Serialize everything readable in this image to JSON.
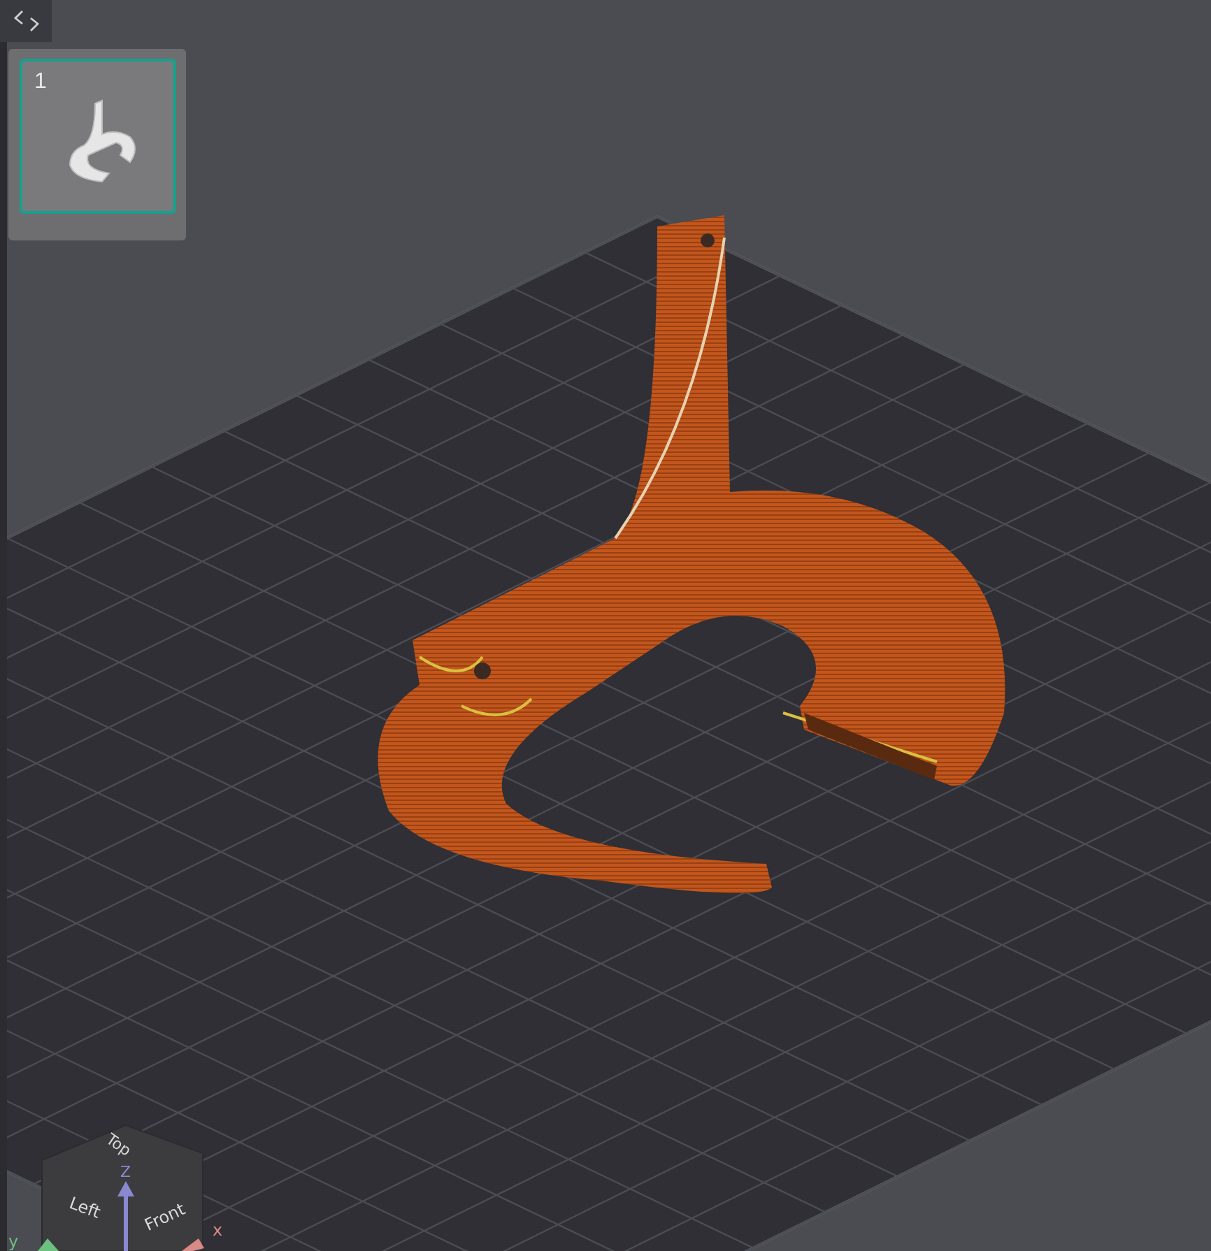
{
  "plate_list": {
    "plates": [
      {
        "number": "1",
        "selected": true
      }
    ]
  },
  "view_cube": {
    "top": "Top",
    "left": "Left",
    "front": "Front"
  },
  "axes": {
    "x": "x",
    "y": "y",
    "z": "Z"
  }
}
